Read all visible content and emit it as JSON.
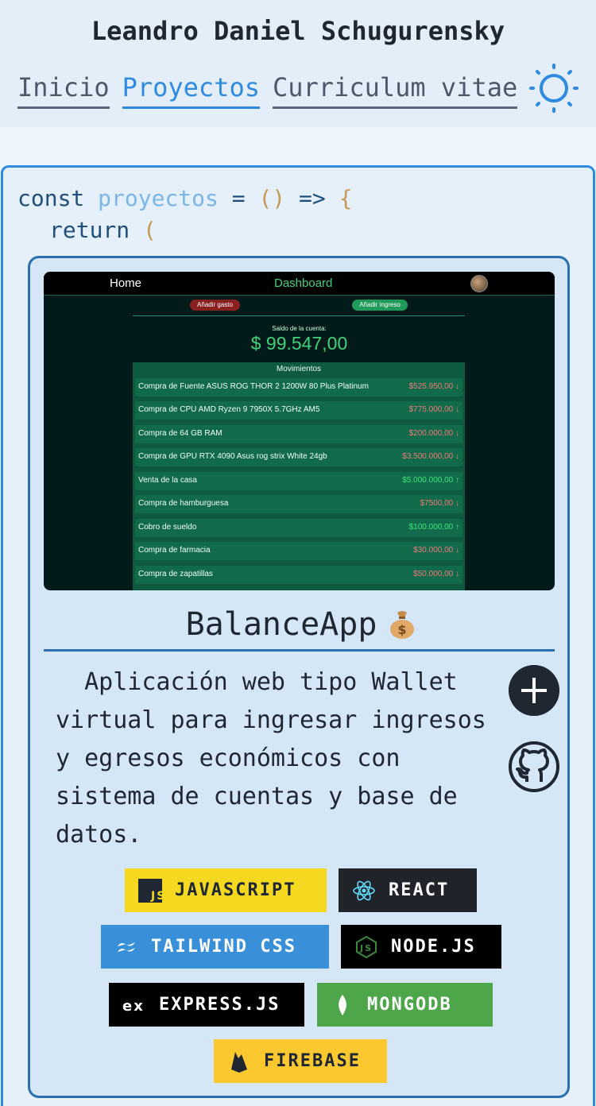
{
  "header": {
    "site_title": "Leandro Daniel Schugurensky",
    "nav": [
      {
        "label": "Inicio",
        "active": false
      },
      {
        "label": "Proyectos",
        "active": true
      },
      {
        "label": "Curriculum vitae",
        "active": false
      }
    ],
    "theme_toggle_icon": "sun-icon",
    "accent_color": "#2e8be0"
  },
  "code": {
    "line1": {
      "kw": "const",
      "var": "proyectos",
      "eq": "=",
      "parens": "()",
      "arrow": "=>",
      "brace": "{"
    },
    "line2": {
      "kw": "return",
      "paren": "("
    }
  },
  "project": {
    "screenshot": {
      "nav_home": "Home",
      "nav_dashboard": "Dashboard",
      "btn_gasto": "Añadir gasto",
      "btn_ingreso": "Añadir ingreso",
      "saldo_label": "Saldo de la cuenta:",
      "saldo_amount": "$ 99.547,00",
      "movimientos_title": "Movimientos",
      "rows": [
        {
          "desc": "Compra de Fuente ASUS ROG THOR 2 1200W 80 Plus Platinum",
          "amount": "$525.950,00 ↓",
          "type": "neg"
        },
        {
          "desc": "Compra de CPU AMD Ryzen 9 7950X 5.7GHz AM5",
          "amount": "$775.000,00 ↓",
          "type": "neg"
        },
        {
          "desc": "Compra de 64 GB RAM",
          "amount": "$200.000,00 ↓",
          "type": "neg"
        },
        {
          "desc": "Compra de GPU RTX 4090 Asus rog strix White 24gb",
          "amount": "$3.500.000,00 ↓",
          "type": "neg"
        },
        {
          "desc": "Venta de la casa",
          "amount": "$5.000.000,00 ↑",
          "type": "pos"
        },
        {
          "desc": "Compra de hamburguesa",
          "amount": "$7500,00 ↓",
          "type": "neg"
        },
        {
          "desc": "Cobro de sueldo",
          "amount": "$100.000,00 ↑",
          "type": "pos"
        },
        {
          "desc": "Compra de farmacia",
          "amount": "$30.000,00 ↓",
          "type": "neg"
        },
        {
          "desc": "Compra de zapatillas",
          "amount": "$50.000,00 ↓",
          "type": "neg"
        }
      ]
    },
    "title": "BalanceApp",
    "title_icon": "money-bag-icon",
    "description": "  Aplicación web tipo Wallet virtual para ingresar ingresos y egresos económicos con sistema de cuentas y base de datos.",
    "actions": {
      "more_icon": "plus-icon",
      "repo_icon": "github-icon"
    },
    "tags": [
      {
        "label": "JAVASCRIPT",
        "icon": "javascript-icon",
        "color": "#f5d820"
      },
      {
        "label": "REACT",
        "icon": "react-icon",
        "color": "#20232a"
      },
      {
        "label": "TAILWIND CSS",
        "icon": "tailwind-icon",
        "color": "#3a8fd9"
      },
      {
        "label": "NODE.JS",
        "icon": "nodejs-icon",
        "color": "#000000"
      },
      {
        "label": "EXPRESS.JS",
        "icon": "express-icon",
        "color": "#000000"
      },
      {
        "label": "MONGODB",
        "icon": "mongodb-icon",
        "color": "#4da64a"
      },
      {
        "label": "FIREBASE",
        "icon": "firebase-icon",
        "color": "#fbc830"
      }
    ]
  }
}
